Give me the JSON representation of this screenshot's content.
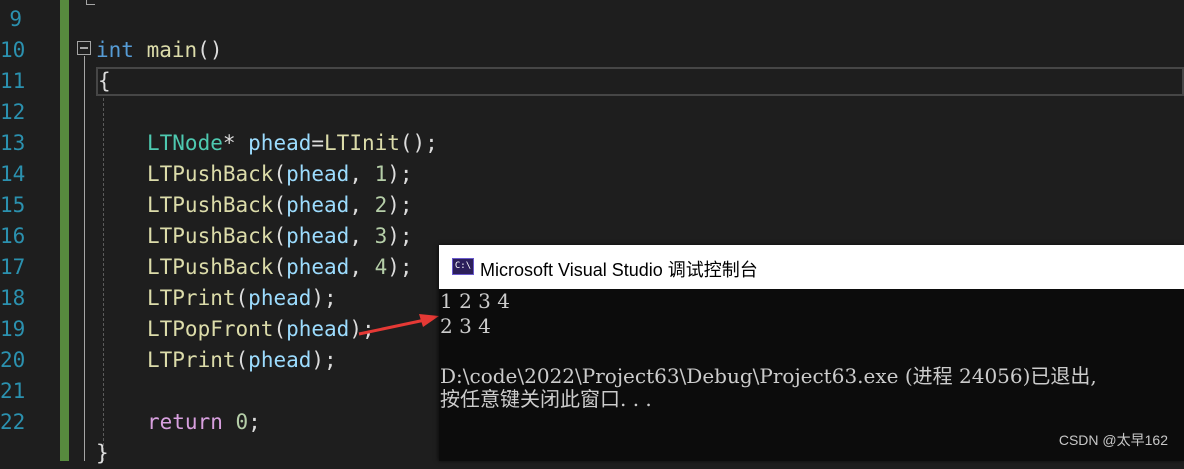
{
  "editor": {
    "line_numbers": [
      "9",
      "10",
      "11",
      "12",
      "13",
      "14",
      "15",
      "16",
      "17",
      "18",
      "19",
      "20",
      "21",
      "22"
    ],
    "main_kw": "int",
    "main_fn": "main",
    "main_parens": "()",
    "open_brace": "{",
    "l13": {
      "type": "LTNode",
      "star": "* ",
      "var": "phead",
      "eq": "=",
      "fn": "LTInit",
      "end": "();"
    },
    "push_fn": "LTPushBack",
    "push_var": "phead",
    "push_vals": [
      "1",
      "2",
      "3",
      "4"
    ],
    "print_fn": "LTPrint",
    "pop_fn": "LTPopFront",
    "return_kw": "return",
    "return_val": "0",
    "semicolon": ";",
    "close_brace": "}"
  },
  "console": {
    "title": "Microsoft Visual Studio 调试控制台",
    "icon_text": "C:\\",
    "lines": [
      "1 2 3 4",
      "2 3 4",
      "",
      "D:\\code\\2022\\Project63\\Debug\\Project63.exe (进程 24056)已退出,",
      "按任意键关闭此窗口. . ."
    ]
  },
  "watermark": "CSDN @太早162",
  "colors": {
    "editor_bg": "#1e1e1e",
    "line_number": "#2b91af",
    "change_bar": "#578a3e",
    "console_bg": "#0c0c0c",
    "arrow": "#e53935"
  }
}
